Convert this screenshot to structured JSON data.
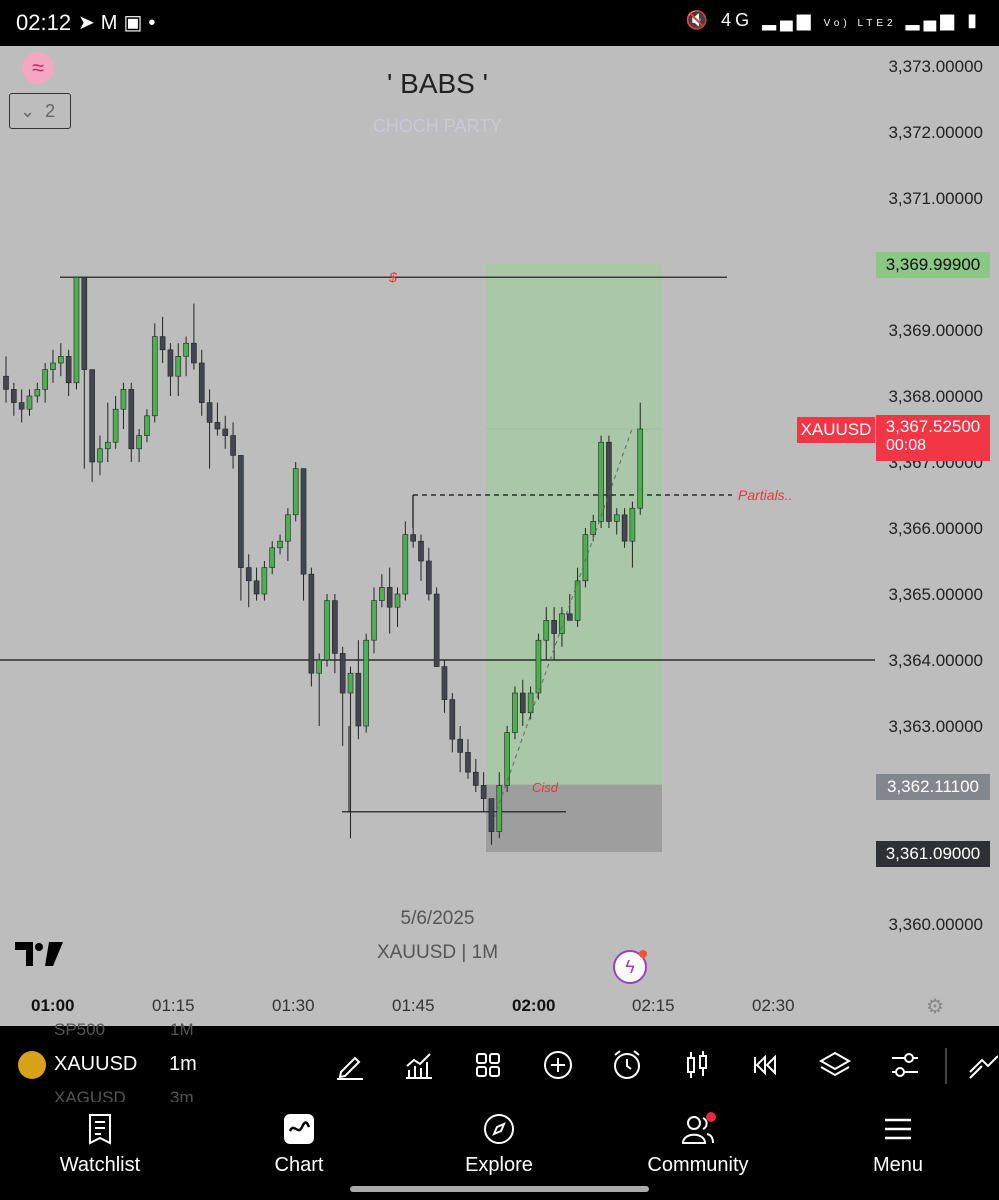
{
  "status_bar": {
    "time": "02:12",
    "left_icons": [
      "telegram-icon",
      "gmail-icon",
      "gallery-icon",
      "dot-icon"
    ],
    "right_icons": [
      "mute-icon",
      "4g-icon",
      "signal-icon",
      "volte-icon",
      "signal2-icon",
      "battery-icon"
    ],
    "network_label": "4G",
    "volte_label": "Vo) LTE2"
  },
  "chart": {
    "title": "' BABS '",
    "subtitle": "CHOCH PARTY",
    "layers_count": "2",
    "date_label": "5/6/2025",
    "symbol_label": "XAUUSD | 1M",
    "horizontal_line_label": "$",
    "partials_label": "Partials..",
    "cisd_label": "Cisd",
    "price_axis": [
      "3,373.00000",
      "3,372.00000",
      "3,371.00000",
      "3,369.00000",
      "3,368.00000",
      "3,367.00000",
      "3,366.00000",
      "3,365.00000",
      "3,364.00000",
      "3,363.00000",
      "3,360.00000"
    ],
    "tags": {
      "target_price": "3,369.99900",
      "current_symbol": "XAUUSD",
      "current_price": "3,367.52500",
      "countdown": "00:08",
      "stop_price": "3,362.11100",
      "entry_price": "3,361.09000"
    },
    "time_axis": [
      "01:00",
      "01:15",
      "01:30",
      "01:45",
      "02:00",
      "02:15",
      "02:30"
    ],
    "colors": {
      "background": "#bdbdbd",
      "bull_candle": "#4caf50",
      "bear_candle": "#434651",
      "target_zone": "#a5c9a2",
      "stop_zone": "#9e9e9e",
      "current_price_tag": "#f23645",
      "target_tag": "#8bc785",
      "stop_tag": "#84868e",
      "annotation_red": "#e53935"
    }
  },
  "chart_data": {
    "type": "candlestick",
    "symbol": "XAUUSD",
    "interval": "1m",
    "ylim": [
      3359.5,
      3373.3
    ],
    "candles": [
      {
        "o": 3368.3,
        "h": 3368.6,
        "l": 3367.9,
        "c": 3368.1
      },
      {
        "o": 3368.1,
        "h": 3368.2,
        "l": 3367.7,
        "c": 3367.9
      },
      {
        "o": 3367.9,
        "h": 3368.1,
        "l": 3367.6,
        "c": 3367.8
      },
      {
        "o": 3367.8,
        "h": 3368.1,
        "l": 3367.7,
        "c": 3368.0
      },
      {
        "o": 3368.0,
        "h": 3368.2,
        "l": 3367.9,
        "c": 3368.1
      },
      {
        "o": 3368.1,
        "h": 3368.5,
        "l": 3367.9,
        "c": 3368.4
      },
      {
        "o": 3368.4,
        "h": 3368.7,
        "l": 3368.2,
        "c": 3368.5
      },
      {
        "o": 3368.5,
        "h": 3368.8,
        "l": 3368.3,
        "c": 3368.6
      },
      {
        "o": 3368.6,
        "h": 3368.7,
        "l": 3368.0,
        "c": 3368.2
      },
      {
        "o": 3368.2,
        "h": 3369.8,
        "l": 3368.1,
        "c": 3369.8
      },
      {
        "o": 3369.8,
        "h": 3369.8,
        "l": 3366.9,
        "c": 3368.4
      },
      {
        "o": 3368.4,
        "h": 3368.4,
        "l": 3366.7,
        "c": 3367.0
      },
      {
        "o": 3367.0,
        "h": 3367.4,
        "l": 3366.8,
        "c": 3367.2
      },
      {
        "o": 3367.2,
        "h": 3367.9,
        "l": 3367.0,
        "c": 3367.3
      },
      {
        "o": 3367.3,
        "h": 3368.0,
        "l": 3367.2,
        "c": 3367.8
      },
      {
        "o": 3367.8,
        "h": 3368.2,
        "l": 3367.5,
        "c": 3368.1
      },
      {
        "o": 3368.1,
        "h": 3368.2,
        "l": 3367.0,
        "c": 3367.2
      },
      {
        "o": 3367.2,
        "h": 3367.5,
        "l": 3367.0,
        "c": 3367.4
      },
      {
        "o": 3367.4,
        "h": 3367.8,
        "l": 3367.3,
        "c": 3367.7
      },
      {
        "o": 3367.7,
        "h": 3369.1,
        "l": 3367.6,
        "c": 3368.9
      },
      {
        "o": 3368.9,
        "h": 3369.2,
        "l": 3368.5,
        "c": 3368.7
      },
      {
        "o": 3368.7,
        "h": 3368.8,
        "l": 3368.0,
        "c": 3368.3
      },
      {
        "o": 3368.3,
        "h": 3368.8,
        "l": 3368.0,
        "c": 3368.6
      },
      {
        "o": 3368.6,
        "h": 3368.9,
        "l": 3368.3,
        "c": 3368.8
      },
      {
        "o": 3368.8,
        "h": 3369.4,
        "l": 3368.4,
        "c": 3368.5
      },
      {
        "o": 3368.5,
        "h": 3368.7,
        "l": 3367.7,
        "c": 3367.9
      },
      {
        "o": 3367.9,
        "h": 3368.1,
        "l": 3366.9,
        "c": 3367.6
      },
      {
        "o": 3367.6,
        "h": 3367.9,
        "l": 3367.4,
        "c": 3367.5
      },
      {
        "o": 3367.5,
        "h": 3367.7,
        "l": 3367.2,
        "c": 3367.4
      },
      {
        "o": 3367.4,
        "h": 3367.6,
        "l": 3366.9,
        "c": 3367.1
      },
      {
        "o": 3367.1,
        "h": 3367.1,
        "l": 3364.9,
        "c": 3365.4
      },
      {
        "o": 3365.4,
        "h": 3365.6,
        "l": 3364.8,
        "c": 3365.2
      },
      {
        "o": 3365.2,
        "h": 3365.4,
        "l": 3364.9,
        "c": 3365.0
      },
      {
        "o": 3365.0,
        "h": 3365.5,
        "l": 3364.9,
        "c": 3365.4
      },
      {
        "o": 3365.4,
        "h": 3365.8,
        "l": 3365.3,
        "c": 3365.7
      },
      {
        "o": 3365.7,
        "h": 3365.9,
        "l": 3365.6,
        "c": 3365.8
      },
      {
        "o": 3365.8,
        "h": 3366.3,
        "l": 3365.5,
        "c": 3366.2
      },
      {
        "o": 3366.2,
        "h": 3367.0,
        "l": 3366.1,
        "c": 3366.9
      },
      {
        "o": 3366.9,
        "h": 3366.9,
        "l": 3364.9,
        "c": 3365.3
      },
      {
        "o": 3365.3,
        "h": 3365.4,
        "l": 3363.6,
        "c": 3363.8
      },
      {
        "o": 3363.8,
        "h": 3364.1,
        "l": 3363.0,
        "c": 3364.0
      },
      {
        "o": 3364.0,
        "h": 3365.0,
        "l": 3363.9,
        "c": 3364.9
      },
      {
        "o": 3364.9,
        "h": 3365.0,
        "l": 3363.8,
        "c": 3364.1
      },
      {
        "o": 3364.1,
        "h": 3364.2,
        "l": 3362.7,
        "c": 3363.5
      },
      {
        "o": 3363.5,
        "h": 3363.9,
        "l": 3361.3,
        "c": 3363.8
      },
      {
        "o": 3363.8,
        "h": 3364.3,
        "l": 3362.8,
        "c": 3363.0
      },
      {
        "o": 3363.0,
        "h": 3364.4,
        "l": 3362.9,
        "c": 3364.3
      },
      {
        "o": 3364.3,
        "h": 3365.1,
        "l": 3364.1,
        "c": 3364.9
      },
      {
        "o": 3364.9,
        "h": 3365.3,
        "l": 3364.8,
        "c": 3365.1
      },
      {
        "o": 3365.1,
        "h": 3365.4,
        "l": 3364.4,
        "c": 3364.8
      },
      {
        "o": 3364.8,
        "h": 3365.1,
        "l": 3364.5,
        "c": 3365.0
      },
      {
        "o": 3365.0,
        "h": 3366.1,
        "l": 3364.9,
        "c": 3365.9
      },
      {
        "o": 3365.9,
        "h": 3366.0,
        "l": 3365.7,
        "c": 3365.8
      },
      {
        "o": 3365.8,
        "h": 3365.9,
        "l": 3365.2,
        "c": 3365.5
      },
      {
        "o": 3365.5,
        "h": 3365.7,
        "l": 3364.9,
        "c": 3365.0
      },
      {
        "o": 3365.0,
        "h": 3365.1,
        "l": 3363.9,
        "c": 3363.9
      },
      {
        "o": 3363.9,
        "h": 3364.0,
        "l": 3363.2,
        "c": 3363.4
      },
      {
        "o": 3363.4,
        "h": 3363.5,
        "l": 3362.6,
        "c": 3362.8
      },
      {
        "o": 3362.8,
        "h": 3363.0,
        "l": 3362.3,
        "c": 3362.6
      },
      {
        "o": 3362.6,
        "h": 3362.8,
        "l": 3362.2,
        "c": 3362.3
      },
      {
        "o": 3362.3,
        "h": 3362.5,
        "l": 3362.0,
        "c": 3362.1
      },
      {
        "o": 3362.1,
        "h": 3362.3,
        "l": 3361.7,
        "c": 3361.9
      },
      {
        "o": 3361.9,
        "h": 3361.9,
        "l": 3361.2,
        "c": 3361.4
      },
      {
        "o": 3361.4,
        "h": 3362.3,
        "l": 3361.3,
        "c": 3362.1
      },
      {
        "o": 3362.1,
        "h": 3363.0,
        "l": 3362.0,
        "c": 3362.9
      },
      {
        "o": 3362.9,
        "h": 3363.6,
        "l": 3362.8,
        "c": 3363.5
      },
      {
        "o": 3363.5,
        "h": 3363.7,
        "l": 3363.0,
        "c": 3363.2
      },
      {
        "o": 3363.2,
        "h": 3363.6,
        "l": 3363.1,
        "c": 3363.5
      },
      {
        "o": 3363.5,
        "h": 3364.4,
        "l": 3363.4,
        "c": 3364.3
      },
      {
        "o": 3364.3,
        "h": 3364.8,
        "l": 3364.0,
        "c": 3364.6
      },
      {
        "o": 3364.6,
        "h": 3364.8,
        "l": 3364.0,
        "c": 3364.4
      },
      {
        "o": 3364.4,
        "h": 3364.8,
        "l": 3364.2,
        "c": 3364.7
      },
      {
        "o": 3364.7,
        "h": 3365.0,
        "l": 3364.6,
        "c": 3364.6
      },
      {
        "o": 3364.6,
        "h": 3365.4,
        "l": 3364.5,
        "c": 3365.2
      },
      {
        "o": 3365.2,
        "h": 3366.0,
        "l": 3365.1,
        "c": 3365.9
      },
      {
        "o": 3365.9,
        "h": 3366.2,
        "l": 3365.8,
        "c": 3366.1
      },
      {
        "o": 3366.1,
        "h": 3367.4,
        "l": 3366.0,
        "c": 3367.3
      },
      {
        "o": 3367.3,
        "h": 3367.4,
        "l": 3366.0,
        "c": 3366.1
      },
      {
        "o": 3366.1,
        "h": 3366.3,
        "l": 3365.9,
        "c": 3366.2
      },
      {
        "o": 3366.2,
        "h": 3366.3,
        "l": 3365.7,
        "c": 3365.8
      },
      {
        "o": 3365.8,
        "h": 3366.4,
        "l": 3365.4,
        "c": 3366.3
      },
      {
        "o": 3366.3,
        "h": 3367.9,
        "l": 3366.2,
        "c": 3367.5
      }
    ],
    "levels": [
      {
        "name": "target-line",
        "price": 3369.8
      },
      {
        "name": "partials-line",
        "price": 3366.5
      },
      {
        "name": "mid-line",
        "price": 3364.0
      },
      {
        "name": "low-line",
        "price": 3361.7
      }
    ],
    "position": {
      "type": "long",
      "entry": 3362.111,
      "target": 3369.999,
      "stop": 3361.09
    },
    "x_ticks": [
      "01:00",
      "01:15",
      "01:30",
      "01:45",
      "02:00",
      "02:15",
      "02:30"
    ]
  },
  "toolbar": {
    "symbol": "XAUUSD",
    "interval": "1m",
    "ghost_above": "SP500",
    "ghost_above_interval": "1M",
    "ghost_below": "XAGUSD",
    "ghost_below_interval": "3m",
    "tools": [
      "pencil-icon",
      "indicators-icon",
      "templates-icon",
      "add-icon",
      "alert-icon",
      "candle-type-icon",
      "replay-icon",
      "layers-icon",
      "settings-sliders-icon",
      "trend-icon"
    ]
  },
  "nav": {
    "items": [
      {
        "label": "Watchlist",
        "icon": "watchlist-icon"
      },
      {
        "label": "Chart",
        "icon": "chart-icon"
      },
      {
        "label": "Explore",
        "icon": "explore-icon"
      },
      {
        "label": "Community",
        "icon": "community-icon"
      },
      {
        "label": "Menu",
        "icon": "menu-icon"
      }
    ]
  }
}
